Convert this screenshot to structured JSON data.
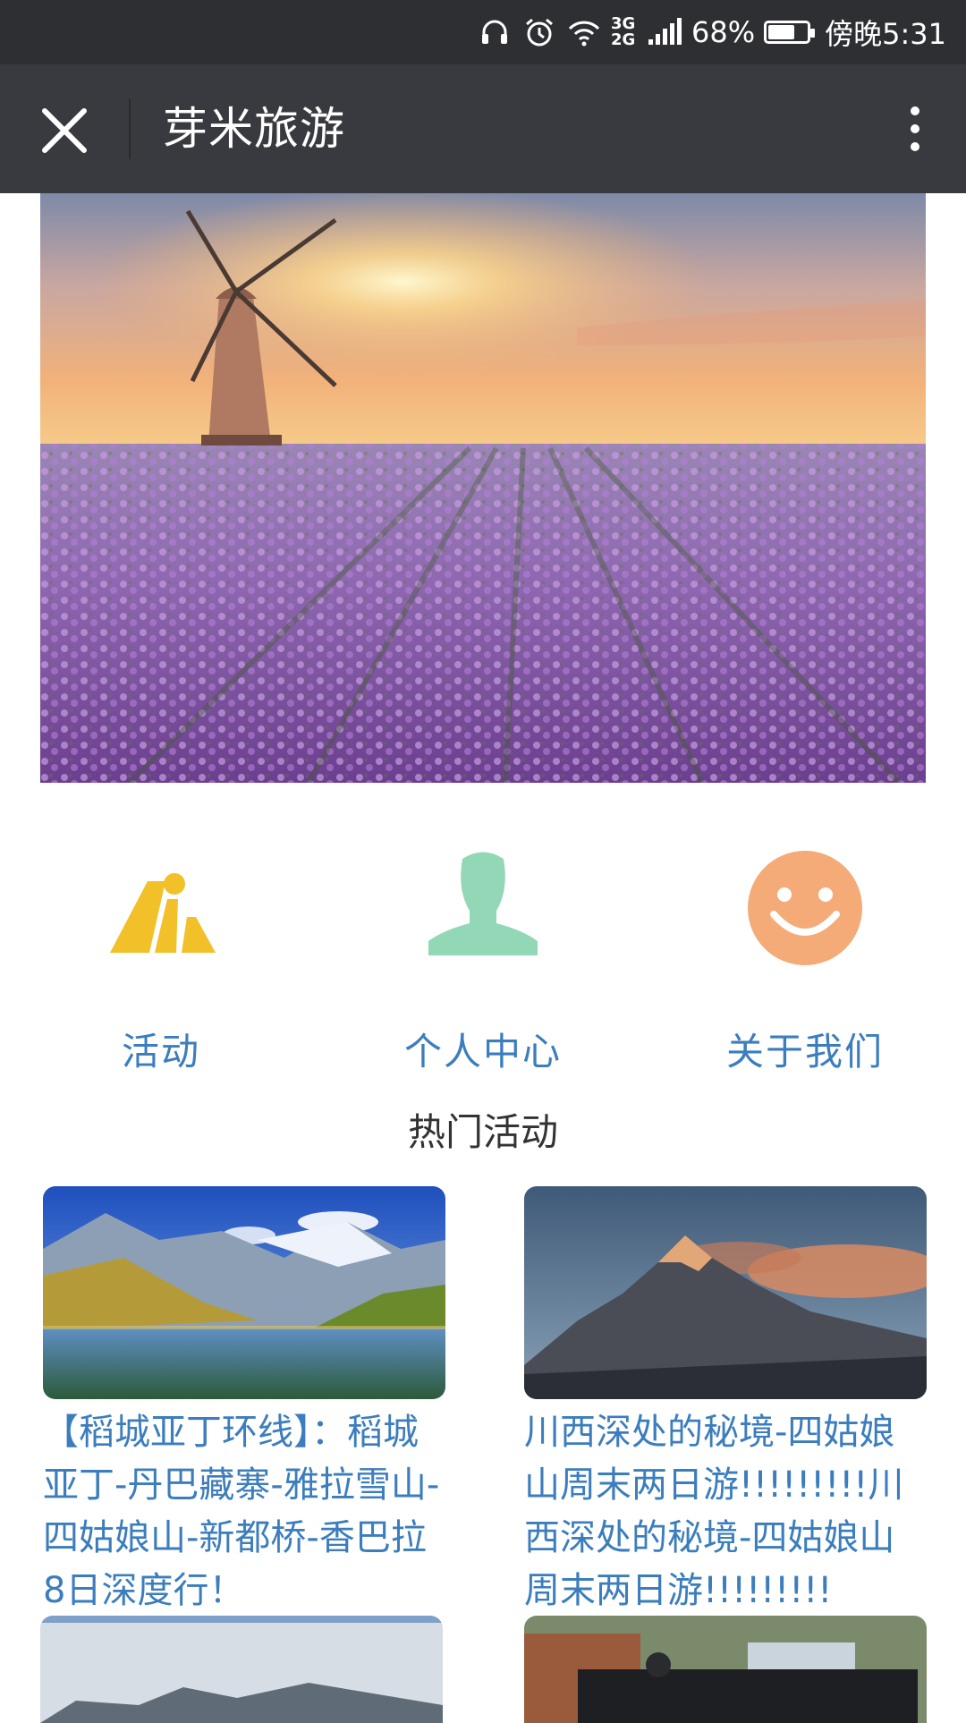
{
  "status_bar": {
    "network": "3G 2G",
    "battery": "68%",
    "battery_level": 0.68,
    "time": "傍晚5:31"
  },
  "header": {
    "title": "芽米旅游"
  },
  "nav": [
    {
      "label": "活动",
      "icon": "mountain-icon",
      "color": "#f2c029"
    },
    {
      "label": "个人中心",
      "icon": "person-icon",
      "color": "#93d8b6"
    },
    {
      "label": "关于我们",
      "icon": "smiley-icon",
      "color": "#f4ab77"
    }
  ],
  "section_title": "热门活动",
  "activities": [
    {
      "title": "【稻城亚丁环线】：稻城亚丁-丹巴藏寨-雅拉雪山-四姑娘山-新都桥-香巴拉8日深度行！"
    },
    {
      "title": "川西深处的秘境-四姑娘山周末两日游!!!!!!!!!川西深处的秘境-四姑娘山周末两日游!!!!!!!!!"
    }
  ],
  "colors": {
    "status_bar_bg": "#2e2f33",
    "title_bar_bg": "#393a3f",
    "link": "#3b7dbd"
  }
}
